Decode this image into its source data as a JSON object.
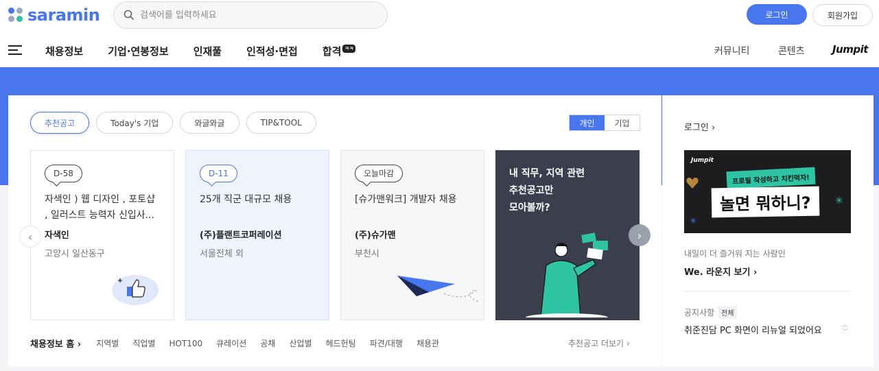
{
  "header": {
    "logo_text": "saramin",
    "search_placeholder": "검색어를 입력하세요",
    "login_label": "로그인",
    "join_label": "회원가입"
  },
  "gnb": {
    "items": [
      "채용정보",
      "기업·연봉정보",
      "인재풀",
      "인적성·면접",
      "합격"
    ],
    "badge": "ㅋㅋ",
    "right": [
      "커뮤니티",
      "콘텐츠"
    ],
    "jumpit": "Jumpit"
  },
  "colors": {
    "brand": "#4876ef",
    "dark_card": "#3a3e4d"
  },
  "main": {
    "tabs": [
      "추천공고",
      "Today's 기업",
      "와글와글",
      "TIP&TOOL"
    ],
    "segment": [
      "개인",
      "기업"
    ],
    "cards": [
      {
        "dday": "D-58",
        "title": "자색인 ) 웹 디자인 , 포토샵 , 일러스트 능력자 신입사...",
        "company": "자색인",
        "location": "고양시 일산동구"
      },
      {
        "dday": "D-11",
        "title": "25개 직군 대규모 채용",
        "company": "(주)플랜트코퍼레이션",
        "location": "서울전체 외"
      },
      {
        "dday": "오늘마감",
        "title": "[슈가맨워크] 개발자 채용",
        "company": "(주)슈가맨",
        "location": "부천시"
      }
    ],
    "promo_text": [
      "내 직무, 지역 관련",
      "추천공고만",
      "모아볼까?"
    ],
    "bottom_home": "채용정보 홈 ›",
    "bottom_links": [
      "지역별",
      "직업별",
      "HOT100",
      "큐레이션",
      "공채",
      "산업별",
      "헤드헌팅",
      "파견/대행",
      "채용관"
    ],
    "more": "추천공고 더보기 ›"
  },
  "side": {
    "login": "로그인 ›",
    "banner": {
      "brand": "Jumpit",
      "tag": "프로필 작성하고 치킨먹자!",
      "headline": "놀면 뭐하니?"
    },
    "desc": "내일이 더 즐거워 지는 사람인",
    "link": "We. 라운지 보기 ›",
    "notice_label": "공지사항",
    "notice_badge": "전체",
    "notice_text": "취준진담 PC 화면이 리뉴얼 되었어요"
  }
}
